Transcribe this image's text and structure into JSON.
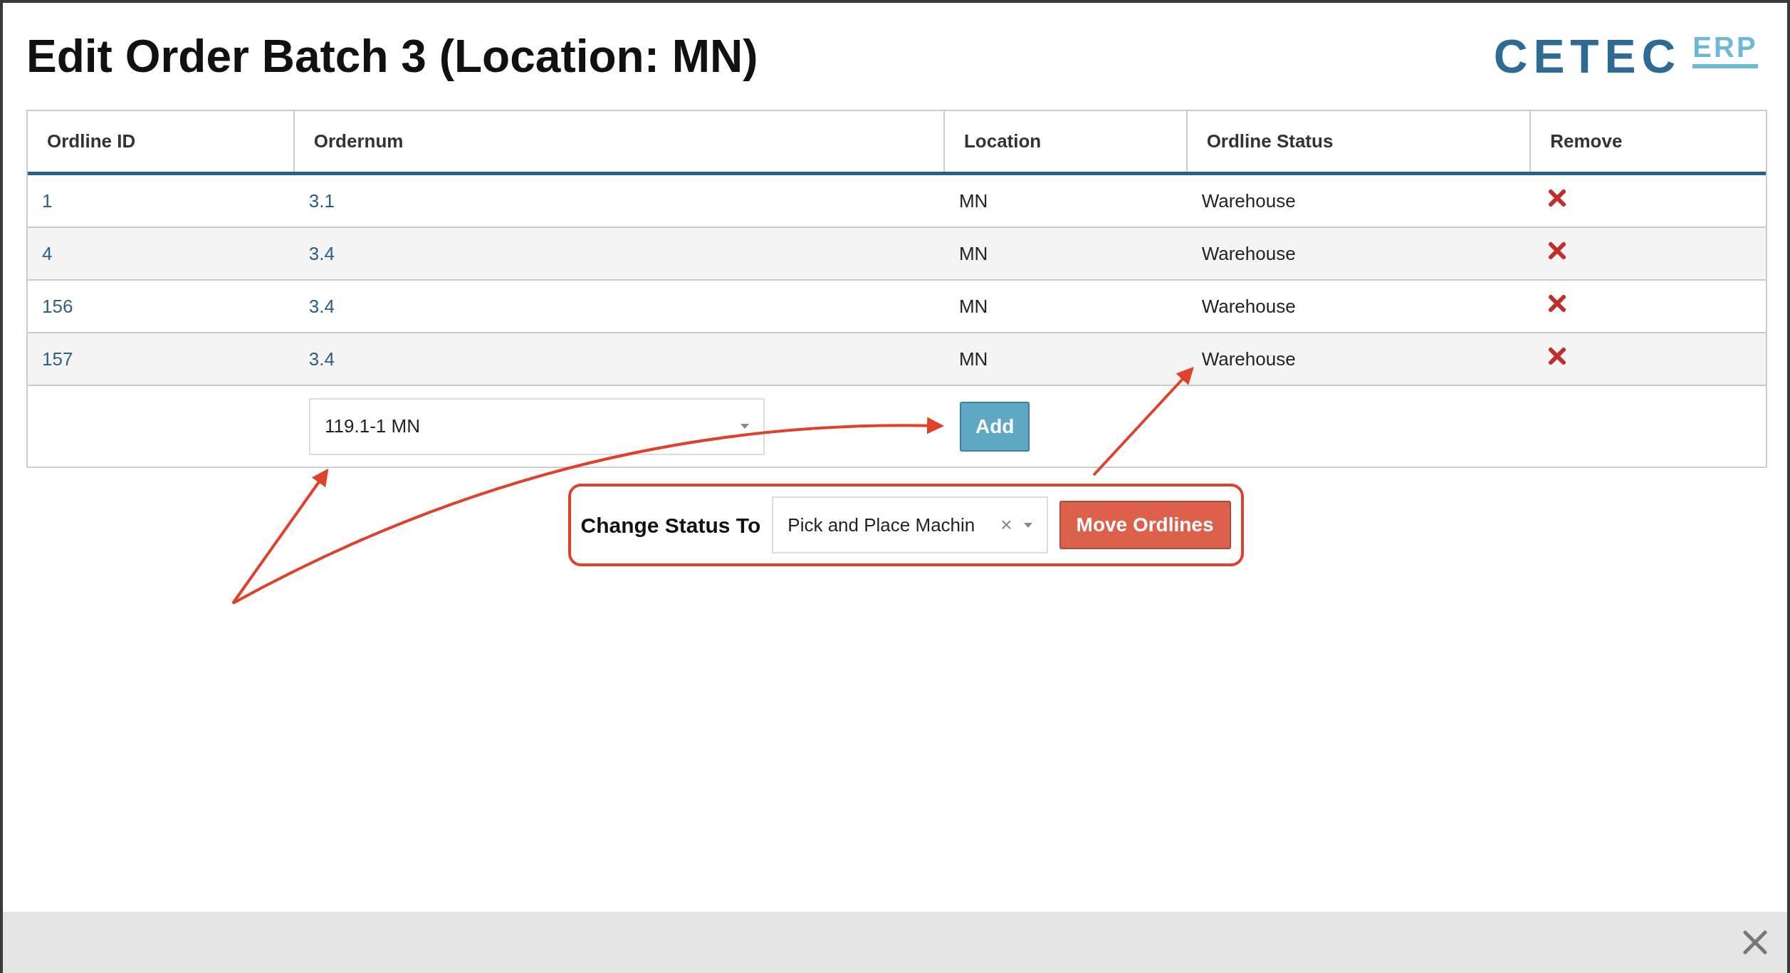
{
  "title": "Edit Order Batch 3 (Location: MN)",
  "logo": {
    "main": "CETEC",
    "sub": "ERP"
  },
  "table": {
    "columns": [
      "Ordline ID",
      "Ordernum",
      "Location",
      "Ordline Status",
      "Remove"
    ],
    "rows": [
      {
        "id": "1",
        "ordernum": "3.1",
        "location": "MN",
        "status": "Warehouse"
      },
      {
        "id": "4",
        "ordernum": "3.4",
        "location": "MN",
        "status": "Warehouse"
      },
      {
        "id": "156",
        "ordernum": "3.4",
        "location": "MN",
        "status": "Warehouse"
      },
      {
        "id": "157",
        "ordernum": "3.4",
        "location": "MN",
        "status": "Warehouse"
      }
    ],
    "add_row": {
      "select_value": "119.1-1 MN",
      "button": "Add"
    }
  },
  "change_status": {
    "label": "Change Status To",
    "select_value": "Pick and Place Machin",
    "clear": "×",
    "button": "Move Ordlines"
  }
}
